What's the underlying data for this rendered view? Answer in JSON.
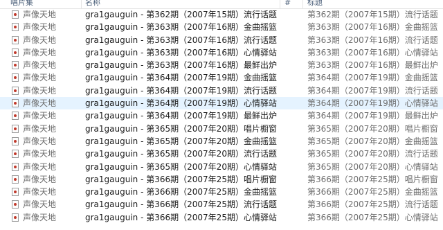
{
  "columns": {
    "album": "唱片集",
    "name": "名称",
    "number": "#",
    "title": "标题"
  },
  "rows": [
    {
      "album": "声像天地",
      "name": "gra1gauguin - 第362期（2007年15期）流行话题",
      "title": "第362期（2007年15期）流行话题"
    },
    {
      "album": "声像天地",
      "name": "gra1gauguin - 第363期（2007年16期）金曲摇篮",
      "title": "第363期（2007年16期）金曲摇篮"
    },
    {
      "album": "声像天地",
      "name": "gra1gauguin - 第363期（2007年16期）流行话题",
      "title": "第363期（2007年16期）流行话题"
    },
    {
      "album": "声像天地",
      "name": "gra1gauguin - 第363期（2007年16期）心情驿站",
      "title": "第363期（2007年16期）心情驿站"
    },
    {
      "album": "声像天地",
      "name": "gra1gauguin - 第363期（2007年16期）最鲜出炉",
      "title": "第363期（2007年16期）最鲜出炉"
    },
    {
      "album": "声像天地",
      "name": "gra1gauguin - 第364期（2007年19期）金曲摇篮",
      "title": "第364期（2007年19期）金曲摇篮"
    },
    {
      "album": "声像天地",
      "name": "gra1gauguin - 第364期（2007年19期）流行话题",
      "title": "第364期（2007年19期）流行话题"
    },
    {
      "album": "声像天地",
      "name": "gra1gauguin - 第364期（2007年19期）心情驿站",
      "title": "第364期（2007年19期）心情驿站"
    },
    {
      "album": "声像天地",
      "name": "gra1gauguin - 第364期（2007年19期）最鲜出炉",
      "title": "第364期（2007年19期）最鲜出炉"
    },
    {
      "album": "声像天地",
      "name": "gra1gauguin - 第365期（2007年20期）唱片橱窗",
      "title": "第365期（2007年20期）唱片橱窗"
    },
    {
      "album": "声像天地",
      "name": "gra1gauguin - 第365期（2007年20期）金曲摇篮",
      "title": "第365期（2007年20期）金曲摇篮"
    },
    {
      "album": "声像天地",
      "name": "gra1gauguin - 第365期（2007年20期）流行话题",
      "title": "第365期（2007年20期）流行话题"
    },
    {
      "album": "声像天地",
      "name": "gra1gauguin - 第365期（2007年20期）心情驿站",
      "title": "第365期（2007年20期）心情驿站"
    },
    {
      "album": "声像天地",
      "name": "gra1gauguin - 第366期（2007年25期）唱片橱窗",
      "title": "第366期（2007年25期）唱片橱窗"
    },
    {
      "album": "声像天地",
      "name": "gra1gauguin - 第366期（2007年25期）金曲摇篮",
      "title": "第366期（2007年25期）金曲摇篮"
    },
    {
      "album": "声像天地",
      "name": "gra1gauguin - 第366期（2007年25期）流行话题",
      "title": "第366期（2007年25期）流行话题"
    },
    {
      "album": "声像天地",
      "name": "gra1gauguin - 第366期（2007年25期）心情驿站",
      "title": "第366期（2007年25期）心情驿站"
    }
  ],
  "selected_row_index": 7,
  "colors": {
    "selected_row_bg": "#e5f3ff",
    "header_text": "#4c607a",
    "secondary_text": "#6d6d6d",
    "primary_text": "#1a1a1a"
  },
  "icons": {
    "row_icon": "audio-file-icon"
  }
}
